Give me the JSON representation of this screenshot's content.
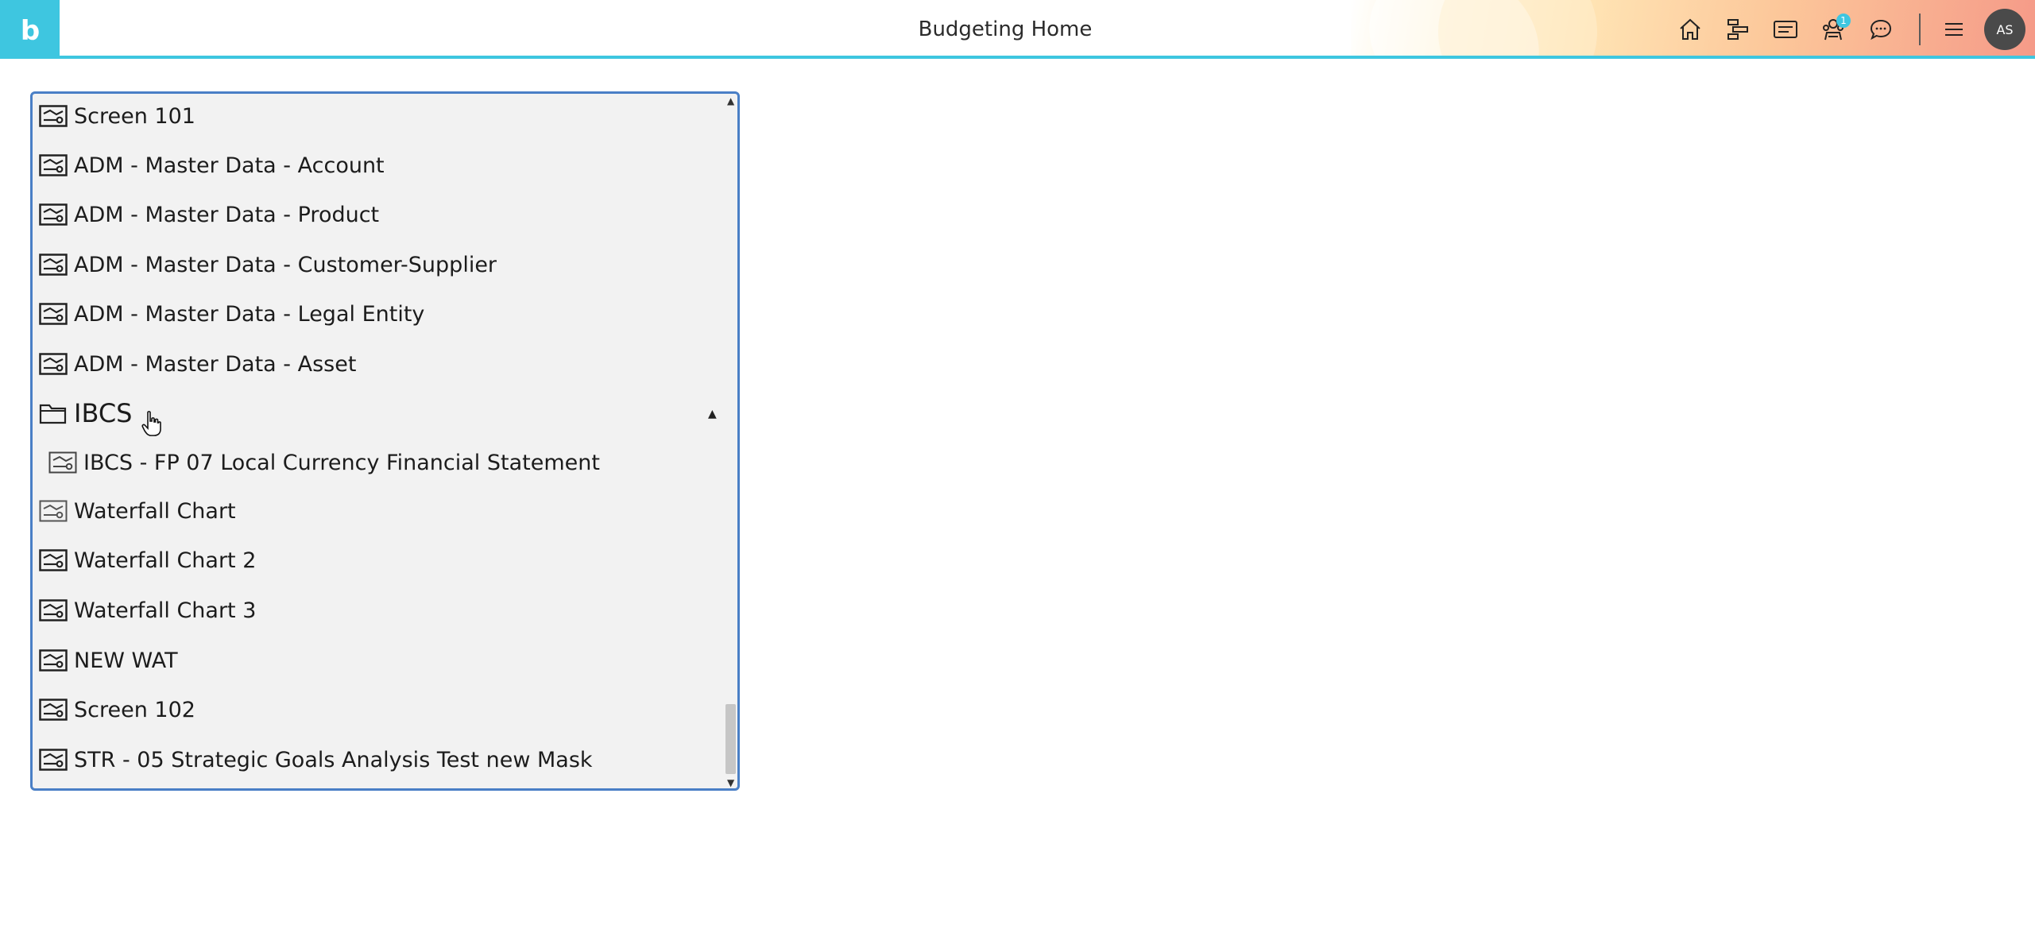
{
  "header": {
    "title": "Budgeting Home",
    "logo_letter": "b",
    "notification_count": "1",
    "avatar_initials": "AS",
    "accent_color": "#3ec6e0",
    "icons": [
      "home-icon",
      "hierarchy-icon",
      "card-icon",
      "team-icon",
      "chat-icon",
      "menu-icon"
    ]
  },
  "tree": {
    "items": [
      {
        "label": "Screen 101",
        "type": "screen"
      },
      {
        "label": "ADM - Master Data - Account",
        "type": "screen"
      },
      {
        "label": "ADM - Master Data - Product",
        "type": "screen"
      },
      {
        "label": "ADM - Master Data - Customer-Supplier",
        "type": "screen"
      },
      {
        "label": "ADM - Master Data - Legal Entity",
        "type": "screen"
      },
      {
        "label": "ADM - Master Data - Asset",
        "type": "screen"
      },
      {
        "label": "IBCS",
        "type": "folder",
        "expanded": true
      },
      {
        "label": "IBCS - FP 07 Local Currency Financial Statement",
        "type": "screen",
        "indent": 1
      },
      {
        "label": "Waterfall Chart",
        "type": "screen"
      },
      {
        "label": "Waterfall Chart 2",
        "type": "screen"
      },
      {
        "label": "Waterfall Chart 3",
        "type": "screen"
      },
      {
        "label": "NEW WAT",
        "type": "screen"
      },
      {
        "label": "Screen 102",
        "type": "screen"
      },
      {
        "label": "STR - 05 Strategic Goals Analysis Test new Mask",
        "type": "screen"
      }
    ]
  }
}
